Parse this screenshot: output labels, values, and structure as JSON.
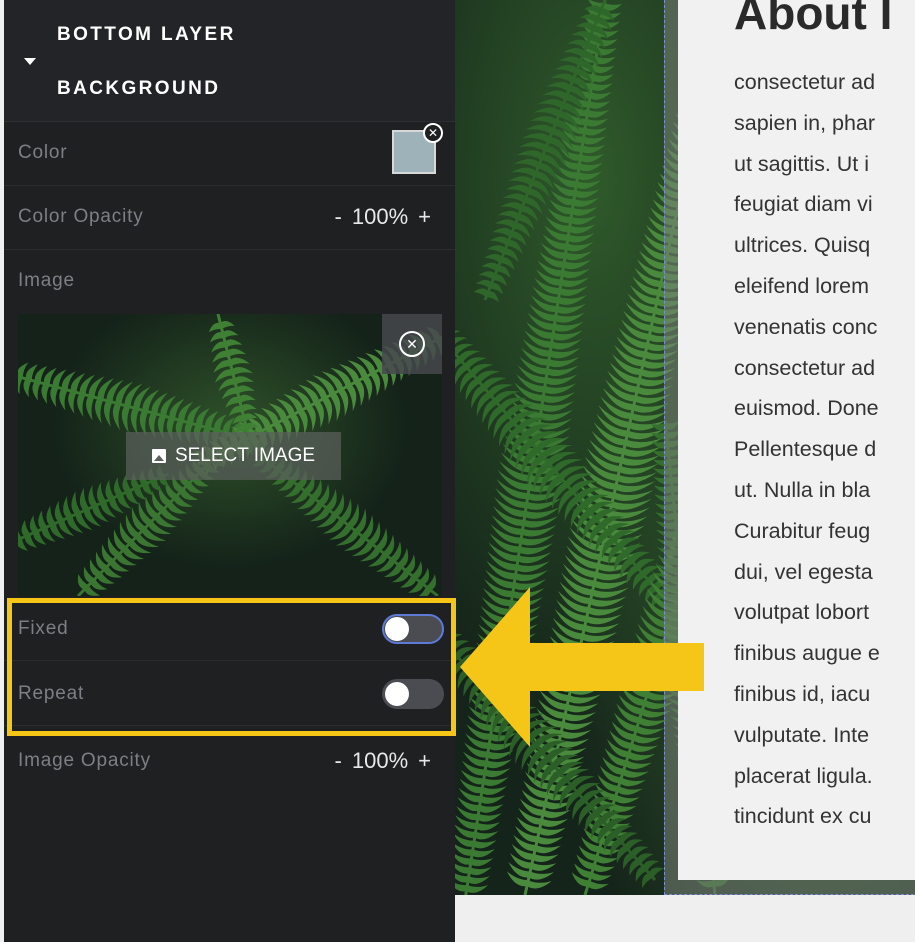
{
  "panel": {
    "header": {
      "line1": "BOTTOM LAYER",
      "line2": "BACKGROUND"
    },
    "color": {
      "label": "Color",
      "swatch_hex": "#9db3b9"
    },
    "color_opacity": {
      "label": "Color Opacity",
      "minus": "-",
      "value": "100%",
      "plus": "+"
    },
    "image": {
      "label": "Image",
      "select_label": "SELECT IMAGE"
    },
    "fixed": {
      "label": "Fixed",
      "on": false
    },
    "repeat": {
      "label": "Repeat",
      "on": false
    },
    "image_opacity": {
      "label": "Image Opacity",
      "minus": "-",
      "value": "100%",
      "plus": "+"
    }
  },
  "content": {
    "title": "About I",
    "lines": [
      "consectetur ad",
      "sapien in, phar",
      "ut sagittis. Ut i",
      "feugiat diam vi",
      "ultrices. Quisq",
      "eleifend lorem",
      "venenatis conc",
      "consectetur ad",
      "euismod. Done",
      "Pellentesque d",
      "ut. Nulla in bla",
      "Curabitur feug",
      "dui, vel egesta",
      "volutpat lobort",
      "finibus augue e",
      "finibus id, iacu",
      "vulputate. Inte",
      "placerat ligula.",
      "tincidunt ex cu"
    ]
  },
  "colors": {
    "highlight": "#f5c518",
    "panel_bg": "#1f2022",
    "toggle_focus": "#5d7bd6"
  },
  "icons": [
    "caret-down-icon",
    "clear-x-icon",
    "remove-image-icon",
    "image-icon",
    "arrow-left-icon"
  ]
}
